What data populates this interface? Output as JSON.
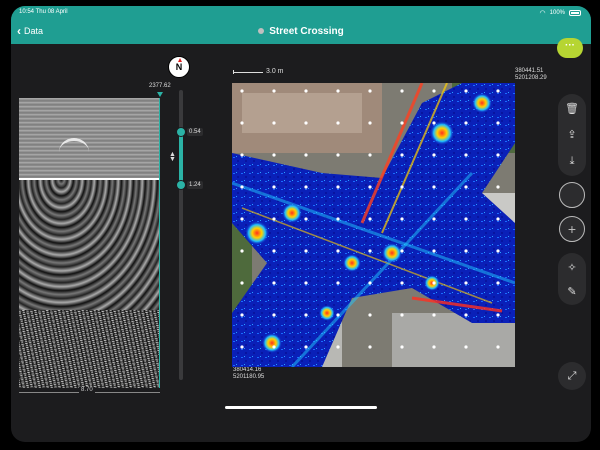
{
  "status_bar": {
    "time": "10:54 Thu 08 April",
    "battery": "100%"
  },
  "nav": {
    "back_label": "Data",
    "title": "Street Crossing",
    "more_label": "···"
  },
  "compass": {
    "label": "N"
  },
  "radargram": {
    "depth_top": "2377.62",
    "distance_label": "8.70"
  },
  "depth_slider": {
    "upper": "0.54",
    "lower": "1.24"
  },
  "map": {
    "scale_label": "3.0 m",
    "coord_top_right": [
      "380441.51",
      "5201208.29"
    ],
    "coord_bottom_left": [
      "380414.16",
      "5201180.95"
    ]
  },
  "icons": {
    "trash": "trash-icon",
    "share": "share-icon",
    "import": "import-icon",
    "magic": "magic-wand-icon",
    "pen": "pen-icon",
    "expand": "expand-icon"
  }
}
